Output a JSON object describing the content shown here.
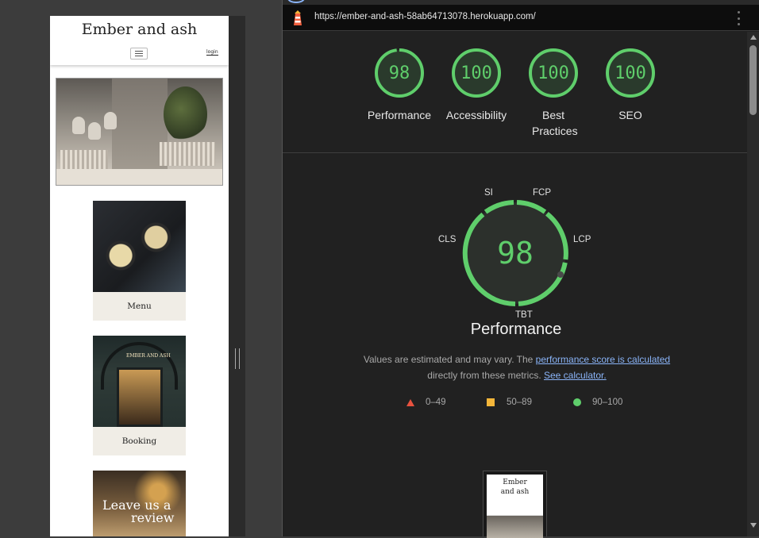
{
  "mobile_preview": {
    "site_title": "Ember and ash",
    "login_label": "login",
    "cards": [
      {
        "caption": "Menu"
      },
      {
        "caption": "Booking"
      },
      {
        "caption": "Leave us a review"
      }
    ],
    "booking_sign": "EMBER AND ASH",
    "review_overlay_line1": "Leave us a",
    "review_overlay_line2": "review"
  },
  "report": {
    "url": "https://ember-and-ash-58ab64713078.herokuapp.com/",
    "categories": [
      {
        "label": "Performance",
        "score": "98",
        "fraction": 0.98
      },
      {
        "label": "Accessibility",
        "score": "100",
        "fraction": 1.0
      },
      {
        "label": "Best Practices",
        "score": "100",
        "fraction": 1.0
      },
      {
        "label": "SEO",
        "score": "100",
        "fraction": 1.0
      }
    ],
    "performance": {
      "score": "98",
      "title": "Performance",
      "metrics": {
        "si": "SI",
        "fcp": "FCP",
        "lcp": "LCP",
        "tbt": "TBT",
        "cls": "CLS"
      },
      "note_prefix": "Values are estimated and may vary. The ",
      "note_link1": "performance score is calculated",
      "note_middle": " directly from these metrics. ",
      "note_link2": "See calculator."
    },
    "legend": [
      {
        "range": "0–49",
        "color": "#e8523f"
      },
      {
        "range": "50–89",
        "color": "#f4b63a"
      },
      {
        "range": "90–100",
        "color": "#5fce6b"
      }
    ],
    "thumbnail_title": "Ember and ash"
  },
  "colors": {
    "pass": "#5fce6b",
    "page_bg": "#212121"
  }
}
